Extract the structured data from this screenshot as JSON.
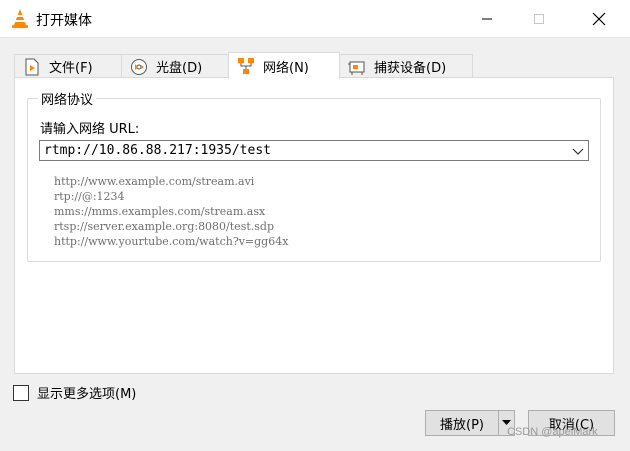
{
  "window": {
    "title": "打开媒体",
    "minimize_icon": "minimize-icon",
    "maximize_icon": "maximize-icon",
    "close_icon": "close-icon",
    "app_icon": "vlc-cone-icon"
  },
  "tabs": [
    {
      "label": "文件(F)",
      "icon": "file-icon",
      "active": false
    },
    {
      "label": "光盘(D)",
      "icon": "disc-icon",
      "active": false
    },
    {
      "label": "网络(N)",
      "icon": "network-icon",
      "active": true
    },
    {
      "label": "捕获设备(D)",
      "icon": "capture-card-icon",
      "active": false
    }
  ],
  "network": {
    "group_title": "网络协议",
    "url_label": "请输入网络 URL:",
    "url_value": "rtmp://10.86.88.217:1935/test",
    "examples": [
      "http://www.example.com/stream.avi",
      "rtp://@:1234",
      "mms://mms.examples.com/stream.asx",
      "rtsp://server.example.org:8080/test.sdp",
      "http://www.yourtube.com/watch?v=gg64x"
    ]
  },
  "options": {
    "more_options_label": "显示更多选项(M)",
    "more_options_checked": false
  },
  "buttons": {
    "play_label": "播放(P)",
    "cancel_label": "取消(C)"
  },
  "watermark": "CSDN @apeiMark",
  "colors": {
    "background": "#f0f0f0",
    "panel": "#ffffff",
    "example_text": "#6f6f6f",
    "vlc_orange": "#ff8800"
  }
}
